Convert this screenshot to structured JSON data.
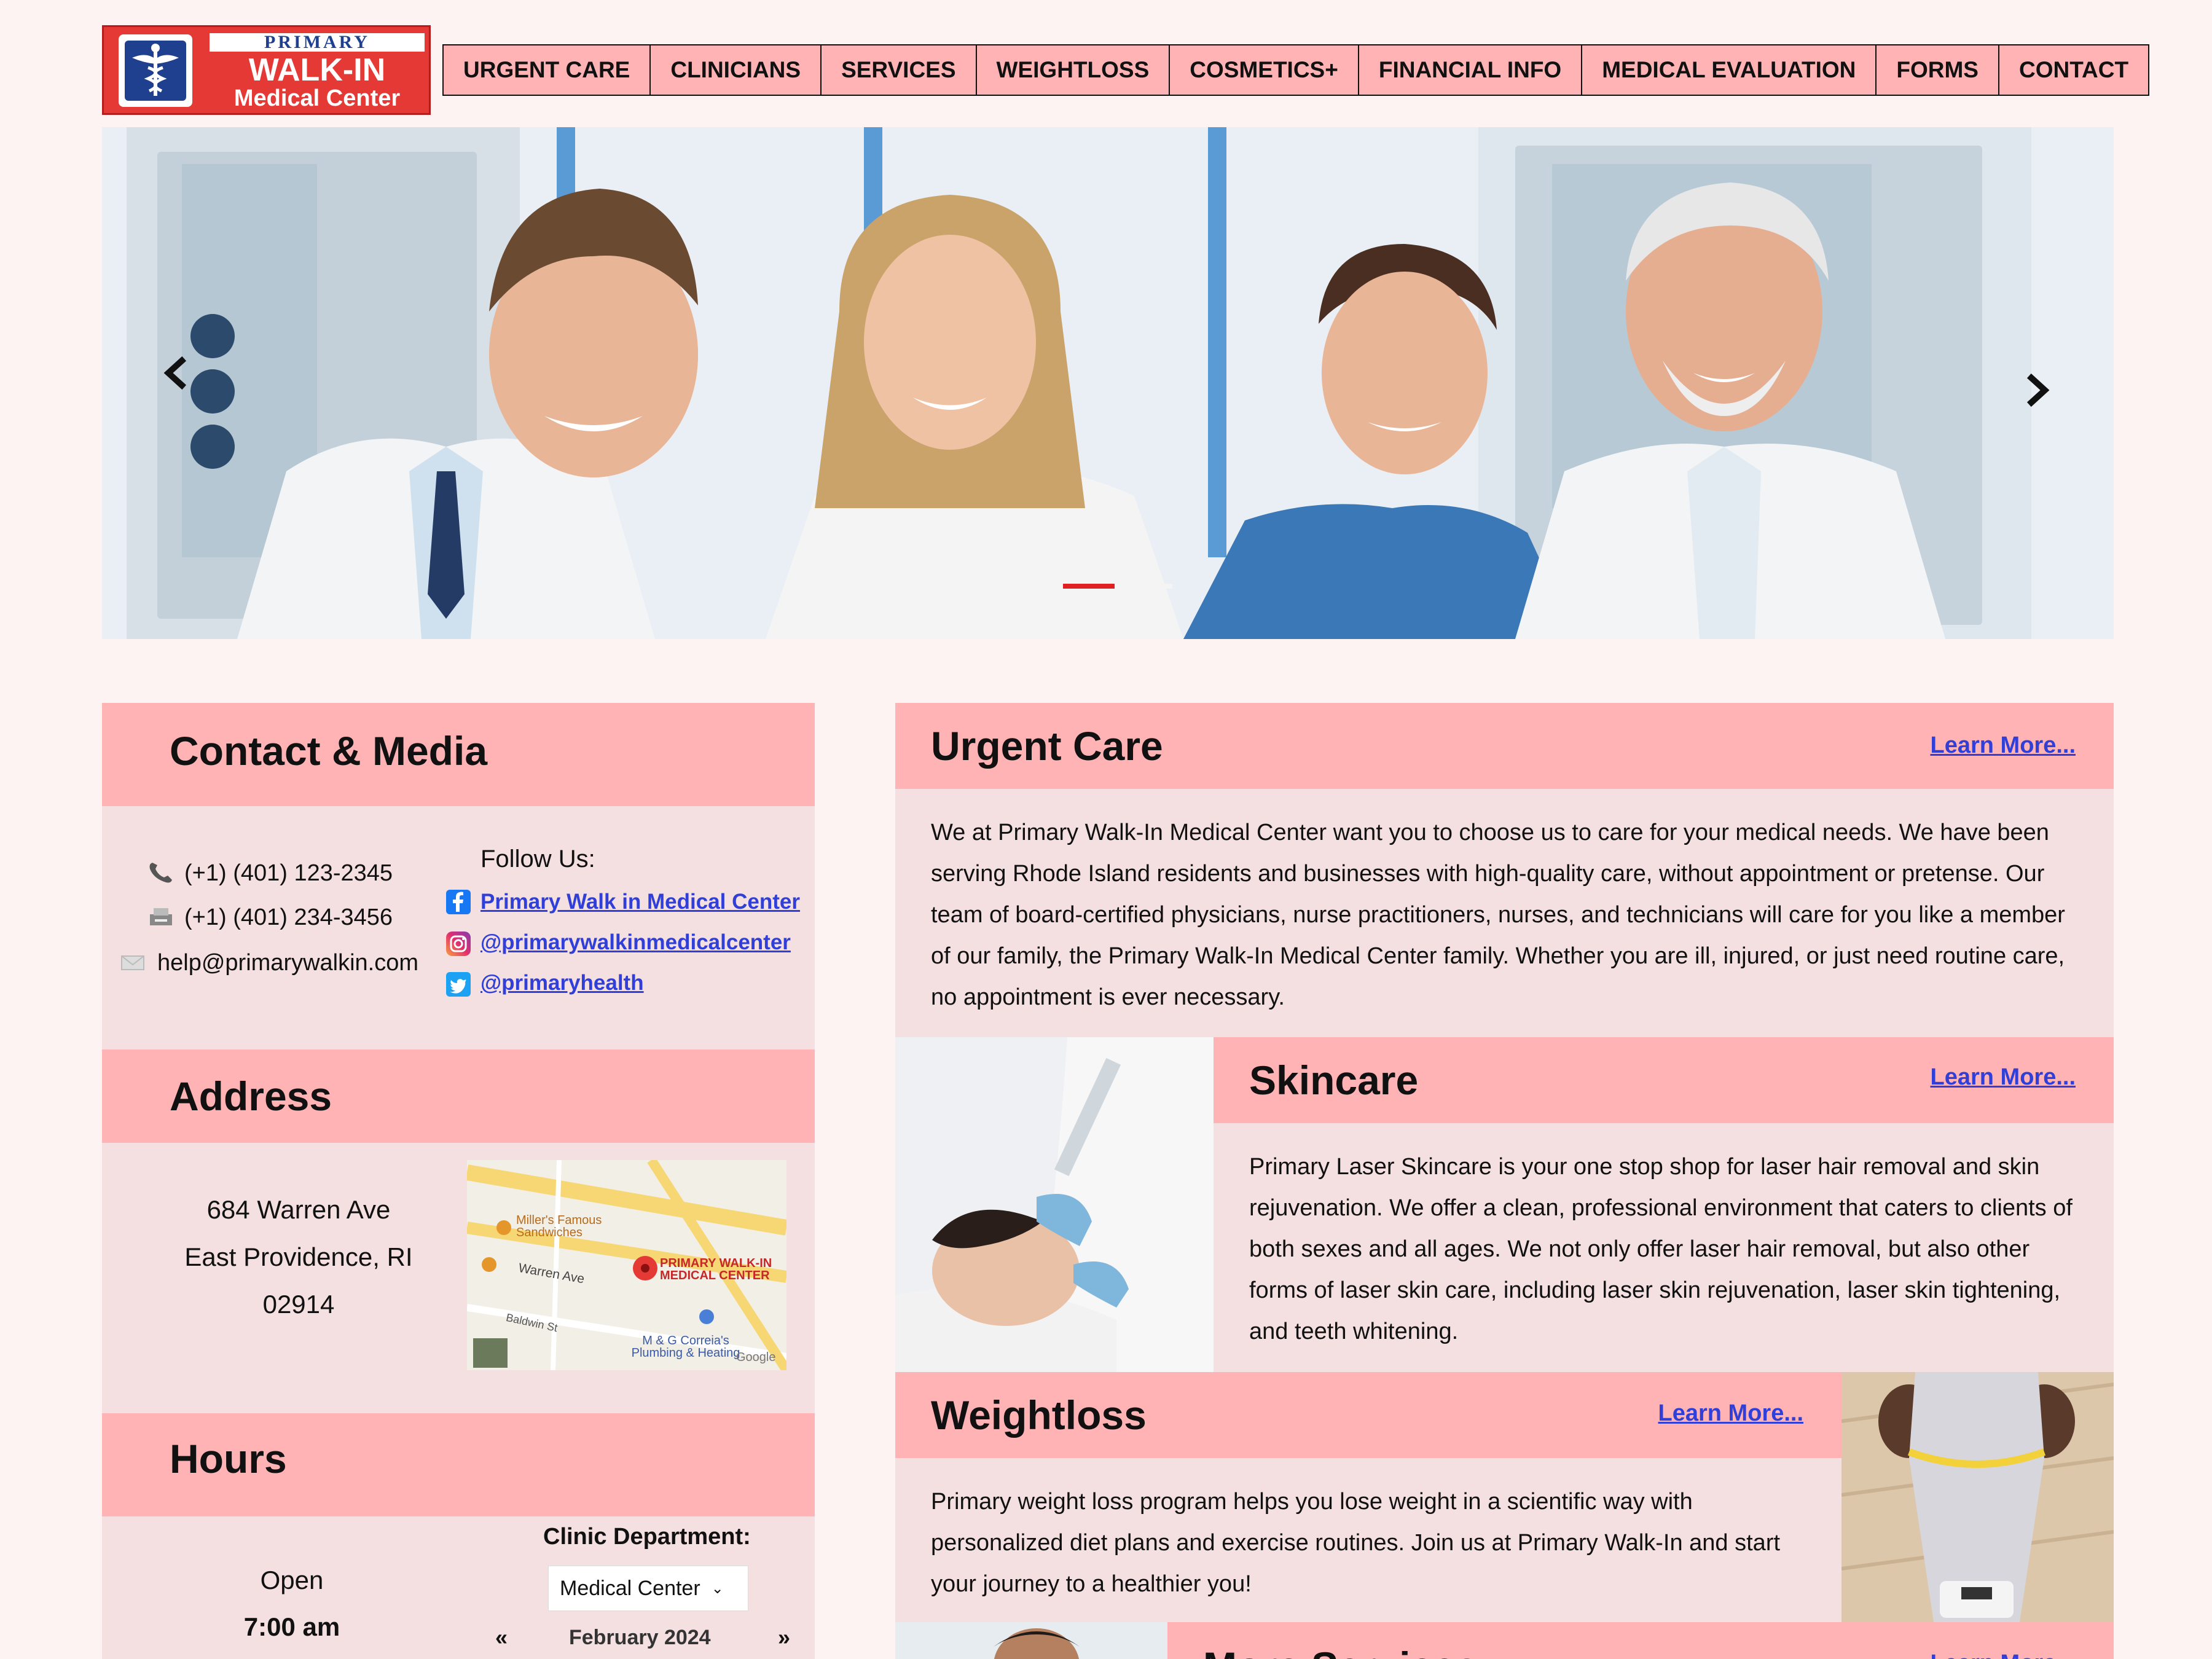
{
  "logo": {
    "line1": "PRIMARY",
    "line2": "WALK-IN",
    "line3": "Medical Center"
  },
  "nav": {
    "items": [
      "URGENT CARE",
      "CLINICIANS",
      "SERVICES",
      "WEIGHTLOSS",
      "COSMETICS+",
      "FINANCIAL INFO",
      "MEDICAL EVALUATION",
      "FORMS",
      "CONTACT"
    ]
  },
  "hero": {
    "active_slide": 2,
    "slide_count": 3,
    "prev_icon": "chevron-left-icon",
    "next_icon": "chevron-right-icon"
  },
  "contact": {
    "title": "Contact & Media",
    "phone": "(+1) (401) 123-2345",
    "fax": "(+1) (401) 234-3456",
    "email": "help@primarywalkin.com",
    "follow_label": "Follow Us:",
    "facebook": "Primary Walk in Medical Center",
    "instagram": "@primarywalkinmedicalcenter",
    "twitter": "@primaryhealth"
  },
  "address": {
    "title": "Address",
    "line1": "684 Warren Ave",
    "line2": "East Providence, RI",
    "line3": "02914",
    "map": {
      "poi1a": "Miller's Famous",
      "poi1b": "Sandwiches",
      "street1": "Warren Ave",
      "pin_a": "PRIMARY WALK-IN",
      "pin_b": "MEDICAL CENTER",
      "street2": "Baldwin St",
      "poi2a": "M & G Correia's",
      "poi2b": "Plumbing & Heating",
      "brand": "Google"
    }
  },
  "hours": {
    "title": "Hours",
    "open_label": "Open",
    "open_time": "7:00 am",
    "dept_label": "Clinic Department:",
    "dept_value": "Medical Center",
    "prev": "«",
    "month": "February 2024",
    "next": "»"
  },
  "urgent": {
    "title": "Urgent Care",
    "link": "Learn More...",
    "text": "We at Primary Walk-In Medical Center want you to choose us to care for your medical needs. We have been serving Rhode Island residents and businesses with high-quality care, without appointment or pretense. Our team of board-certified physicians, nurse practitioners, nurses, and technicians will care for you like a member of our family, the Primary Walk-In Medical Center family. Whether you are ill, injured, or just need routine care, no appointment is ever necessary."
  },
  "skincare": {
    "title": "Skincare",
    "link": "Learn More...",
    "text": "Primary Laser Skincare is your one stop shop for laser hair removal and skin rejuvenation. We offer a clean, professional environment that caters to clients of both sexes and all ages. We not only offer laser hair removal, but also other forms of laser skin care, including laser skin rejuvenation, laser skin tightening, and teeth whitening."
  },
  "weightloss": {
    "title": "Weightloss",
    "link": "Learn More...",
    "text": "Primary weight loss program helps you lose weight in a scientific way with personalized diet plans and exercise routines. Join us at Primary Walk-In and start your journey to a healthier you!"
  },
  "more": {
    "title": "More Services",
    "link": "Learn More..."
  },
  "colors": {
    "accent_pink": "#ffb3b5",
    "panel_bg": "#f4e0e0",
    "link_blue": "#2f3fd8",
    "logo_red": "#e53935"
  }
}
